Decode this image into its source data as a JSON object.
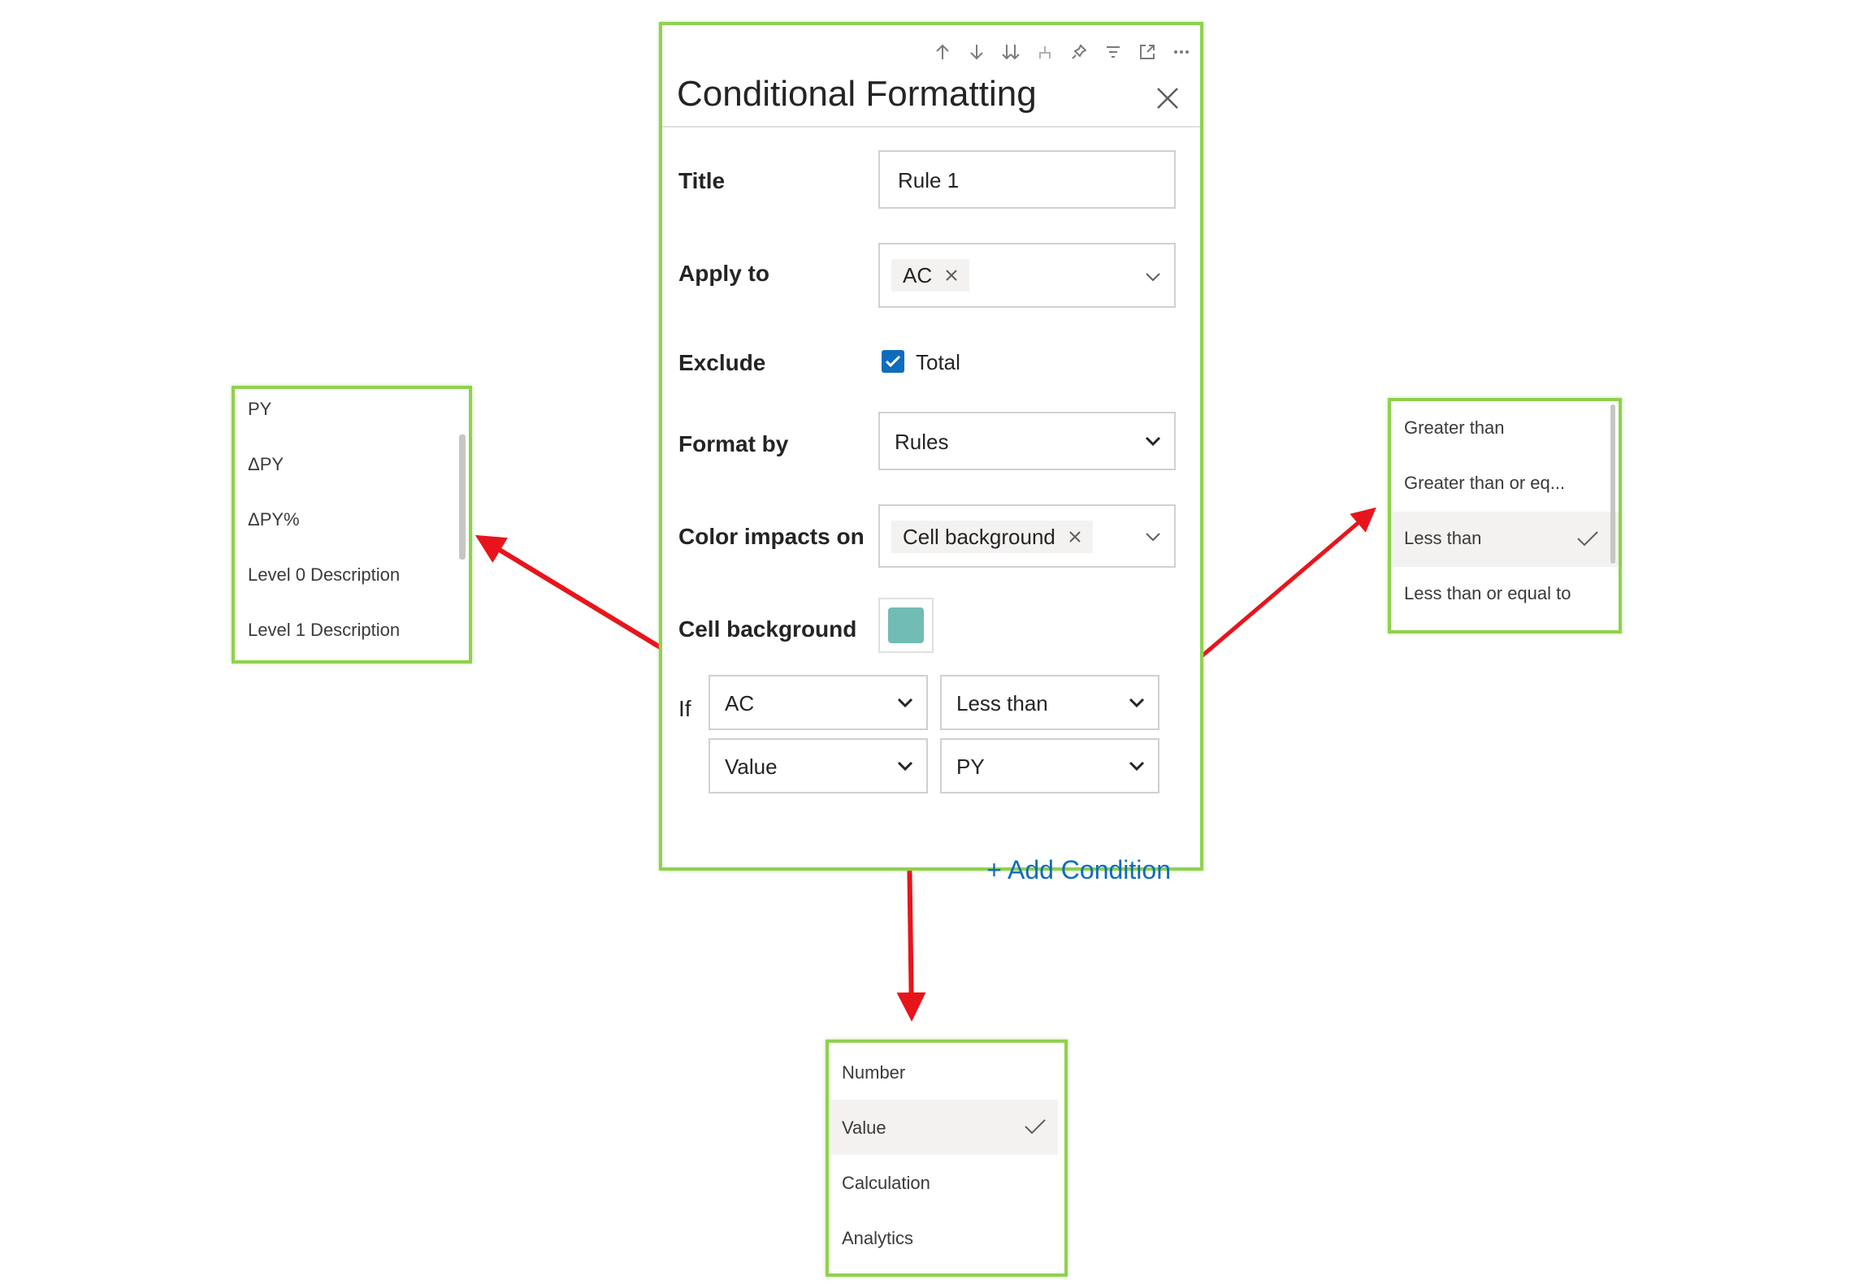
{
  "panel": {
    "title": "Conditional Formatting",
    "fields": {
      "title_label": "Title",
      "title_value": "Rule 1",
      "apply_label": "Apply to",
      "apply_chip": "AC",
      "exclude_label": "Exclude",
      "exclude_option": "Total",
      "exclude_checked": true,
      "format_label": "Format by",
      "format_value": "Rules",
      "color_label": "Color impacts on",
      "color_chip": "Cell background",
      "cellbg_label": "Cell background",
      "cellbg_color": "#71bcb4"
    },
    "condition": {
      "if_label": "If",
      "field": "AC",
      "operator": "Less than",
      "value_type": "Value",
      "compare_to": "PY"
    },
    "add_condition": "+ Add Condition",
    "toolbar_icons": [
      "arrow-up-icon",
      "arrow-down-icon",
      "double-arrow-down-icon",
      "drill-icon",
      "pin-icon",
      "filter-icon",
      "focus-mode-icon",
      "more-options-icon"
    ]
  },
  "field_list": {
    "items": [
      "PY",
      "ΔPY",
      "ΔPY%",
      "Level 0 Description",
      "Level 1 Description"
    ]
  },
  "operator_list": {
    "items": [
      "Greater than",
      "Greater than or eq...",
      "Less than",
      "Less than or equal to"
    ],
    "selected": "Less than"
  },
  "value_type_list": {
    "items": [
      "Number",
      "Value",
      "Calculation",
      "Analytics"
    ],
    "selected": "Value"
  },
  "colors": {
    "highlight_border": "#8fd14f",
    "arrow": "#e8141b",
    "accent": "#0f6cbd"
  }
}
